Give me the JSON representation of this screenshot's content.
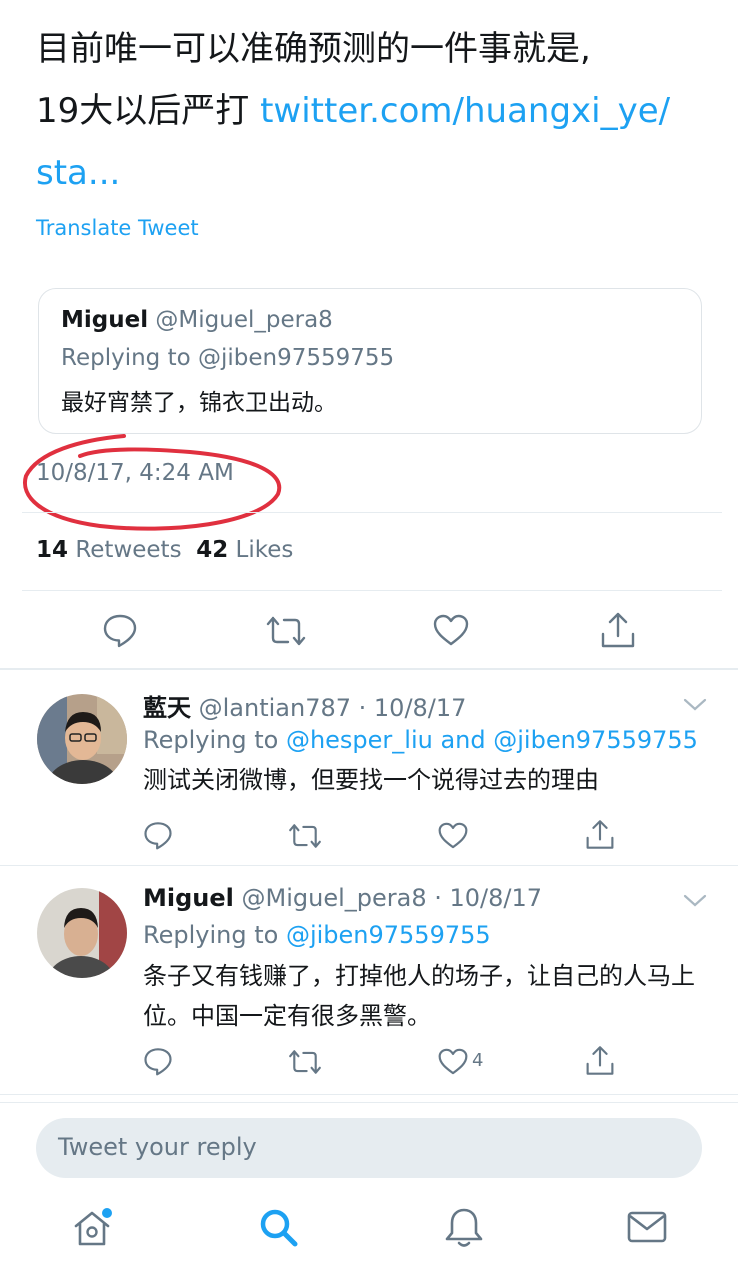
{
  "tweet": {
    "text_line1": "目前唯一可以准确预测的一件事就是,",
    "text_line2": "19大以后严打 ",
    "link_part1": "twitter.com/huangxi_ye/",
    "link_part2": "sta...",
    "translate_label": "Translate Tweet",
    "timestamp": "10/8/17, 4:24 AM",
    "retweets_count": "14",
    "retweets_label": " Retweets",
    "likes_count": "42",
    "likes_label": " Likes"
  },
  "quoted": {
    "name": "Miguel",
    "handle": " @Miguel_pera8",
    "replying_to": "Replying to @jiben97559755",
    "text": "最好宵禁了，锦衣卫出动。"
  },
  "replies": [
    {
      "name": "藍天",
      "meta": " @lantian787 · 10/8/17",
      "replying_prefix": "Replying to ",
      "replying_handles": "@hesper_liu and @jiben97559755",
      "text": "测试关闭微博，但要找一个说得过去的理由",
      "like_count": ""
    },
    {
      "name": "Miguel",
      "meta": " @Miguel_pera8 · 10/8/17",
      "replying_prefix": "Replying to ",
      "replying_handles": "@jiben97559755",
      "text": "条子又有钱赚了，打掉他人的场子，让自己的人马上位。中国一定有很多黑警。",
      "like_count": "4"
    }
  ],
  "compose": {
    "placeholder": "Tweet your reply"
  },
  "tabs": [
    "home-icon",
    "search-icon",
    "notifications-icon",
    "messages-icon"
  ],
  "colors": {
    "accent": "#1da1f2",
    "secondary_text": "#657786",
    "annotation": "#e0303f"
  }
}
